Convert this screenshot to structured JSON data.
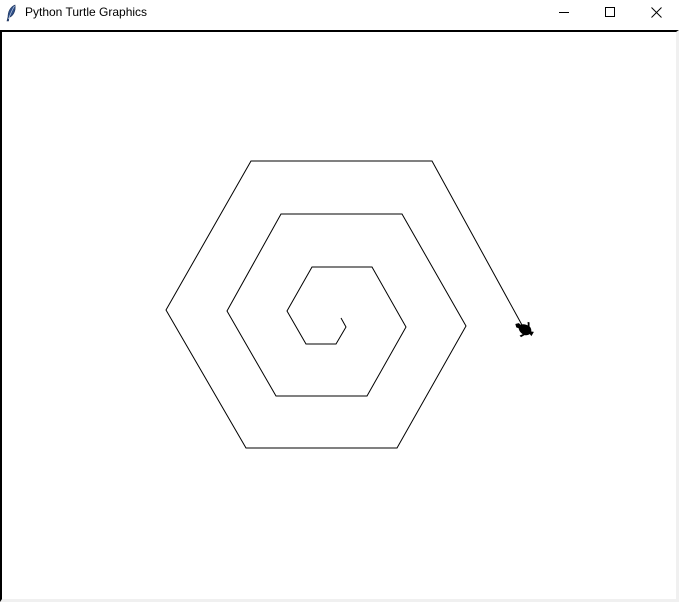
{
  "window": {
    "title": "Python Turtle Graphics",
    "app_icon": "feather-icon",
    "controls": {
      "minimize": "minimize-icon",
      "maximize": "maximize-icon",
      "close": "close-icon"
    }
  },
  "canvas": {
    "background": "#ffffff",
    "pen_color": "#000000",
    "turtle_shape": "turtle",
    "turtle_color": "#000000",
    "drawing": "hexagonal-spiral"
  }
}
